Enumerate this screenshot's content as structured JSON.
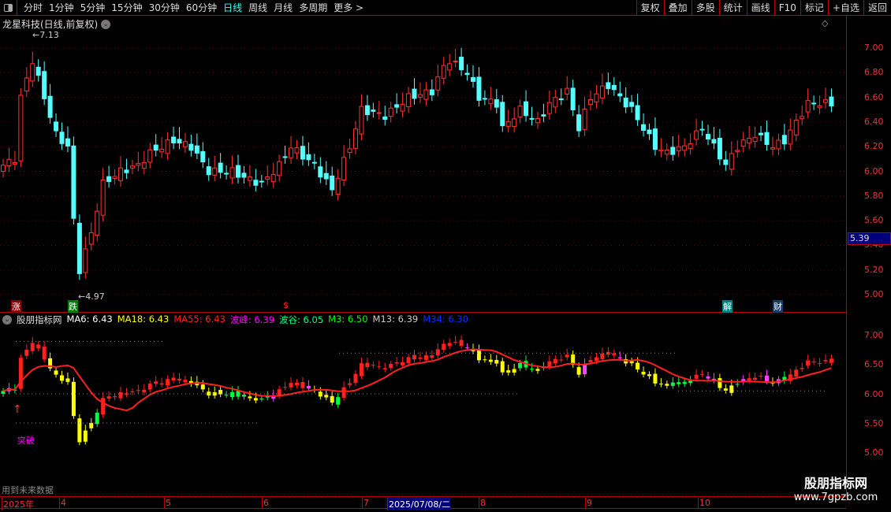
{
  "toolbar": {
    "periods": [
      "分时",
      "1分钟",
      "5分钟",
      "15分钟",
      "30分钟",
      "60分钟",
      "日线",
      "周线",
      "月线",
      "多周期",
      "更多 >"
    ],
    "active": "日线",
    "right": [
      "复权",
      "叠加",
      "多股",
      "统计",
      "画线",
      "F10",
      "标记",
      "+自选",
      "返回"
    ]
  },
  "title": "龙星科技(日线,前复权)",
  "main": {
    "high_label": "7.13",
    "low_label": "4.97",
    "price_ticks": [
      "7.00",
      "6.80",
      "6.60",
      "6.40",
      "6.20",
      "6.00",
      "5.80",
      "5.60",
      "5.40",
      "5.20",
      "5.00"
    ],
    "cursor_price": "5.39",
    "tags": [
      {
        "text": "涨",
        "color": "#8b0000"
      },
      {
        "text": "跌",
        "color": "#008000"
      },
      {
        "text": "$",
        "color": "#000"
      },
      {
        "text": "解",
        "color": "#008080"
      },
      {
        "text": "财",
        "color": "#1a3a6a"
      }
    ]
  },
  "indicator": {
    "name": "股朋指标网",
    "values": [
      {
        "k": "MA6: 6.43",
        "c": "#ffffff"
      },
      {
        "k": "MA18: 6.43",
        "c": "#ffff00"
      },
      {
        "k": "MA55: 6.43",
        "c": "#ff2020"
      },
      {
        "k": "波峰: 6.39",
        "c": "#ff00ff"
      },
      {
        "k": "波谷: 6.05",
        "c": "#00ff80"
      },
      {
        "k": "M3: 6.50",
        "c": "#00ff00"
      },
      {
        "k": "M13: 6.39",
        "c": "#cccccc"
      },
      {
        "k": "M34: 6.30",
        "c": "#0030ff"
      }
    ],
    "ticks": [
      "7.00",
      "6.50",
      "6.00",
      "5.50",
      "5.00"
    ],
    "signal": "突破",
    "note": "用到未来数据"
  },
  "dates": {
    "labels": [
      "2025年",
      "4",
      "5",
      "6",
      "7",
      "2025/07/08/二",
      "8",
      "9",
      "10"
    ]
  },
  "watermark": {
    "name": "股朋指标网",
    "url": "www.7gpzb.com"
  },
  "chart_data": {
    "type": "candlestick",
    "keypoints": [
      [
        0,
        6.05
      ],
      [
        2,
        6.1
      ],
      [
        3,
        6.6
      ],
      [
        5,
        6.9
      ],
      [
        7,
        6.6
      ],
      [
        9,
        6.3
      ],
      [
        11,
        6.2
      ],
      [
        12,
        5.6
      ],
      [
        13,
        5.2
      ],
      [
        15,
        5.5
      ],
      [
        17,
        5.9
      ],
      [
        20,
        6.0
      ],
      [
        23,
        6.05
      ],
      [
        25,
        6.15
      ],
      [
        29,
        6.25
      ],
      [
        32,
        6.2
      ],
      [
        35,
        6.0
      ],
      [
        39,
        6.0
      ],
      [
        41,
        5.95
      ],
      [
        44,
        5.9
      ],
      [
        47,
        6.05
      ],
      [
        49,
        6.2
      ],
      [
        53,
        6.05
      ],
      [
        56,
        5.85
      ],
      [
        59,
        6.2
      ],
      [
        61,
        6.5
      ],
      [
        65,
        6.45
      ],
      [
        69,
        6.6
      ],
      [
        73,
        6.65
      ],
      [
        75,
        6.85
      ],
      [
        76,
        6.9
      ],
      [
        79,
        6.8
      ],
      [
        81,
        6.6
      ],
      [
        84,
        6.55
      ],
      [
        85,
        6.35
      ],
      [
        88,
        6.5
      ],
      [
        91,
        6.4
      ],
      [
        93,
        6.55
      ],
      [
        96,
        6.65
      ],
      [
        98,
        6.35
      ],
      [
        100,
        6.6
      ],
      [
        103,
        6.7
      ],
      [
        107,
        6.5
      ],
      [
        111,
        6.2
      ],
      [
        113,
        6.15
      ],
      [
        116,
        6.2
      ],
      [
        119,
        6.35
      ],
      [
        121,
        6.2
      ],
      [
        123,
        6.05
      ],
      [
        125,
        6.2
      ],
      [
        128,
        6.3
      ],
      [
        131,
        6.2
      ],
      [
        133,
        6.25
      ],
      [
        135,
        6.4
      ],
      [
        137,
        6.55
      ],
      [
        141,
        6.55
      ]
    ]
  }
}
